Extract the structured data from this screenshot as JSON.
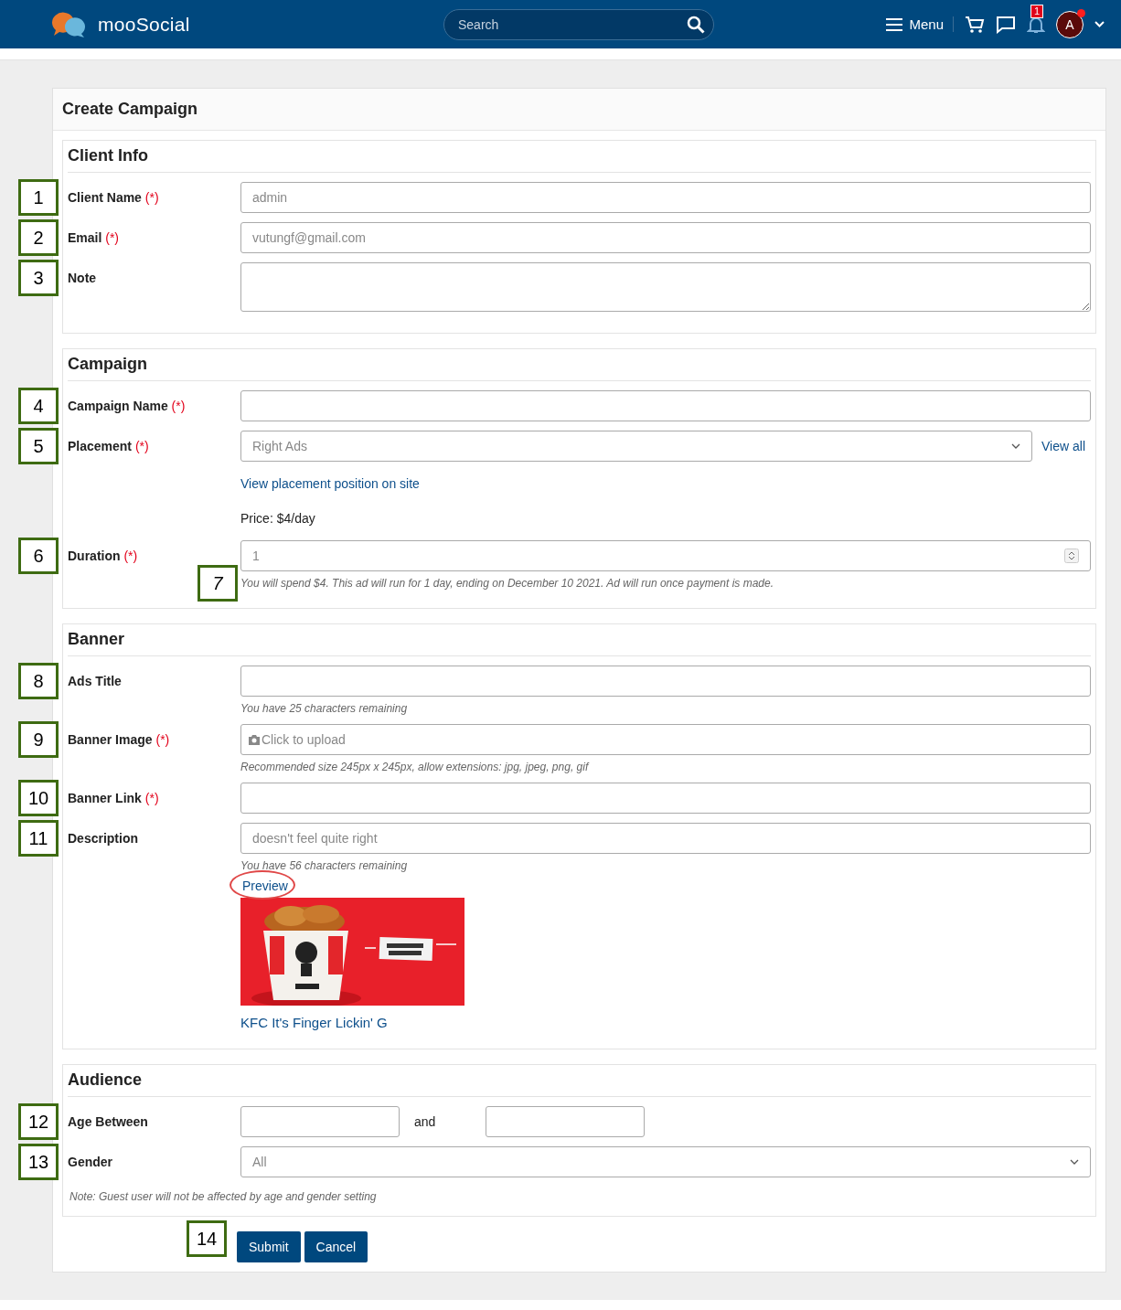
{
  "header": {
    "logo_text": "mooSocial",
    "search": {
      "placeholder": "Search"
    },
    "menu_label": "Menu",
    "notification_count": "1",
    "avatar_letter": "A"
  },
  "page": {
    "title": "Create Campaign"
  },
  "sections": [
    {
      "title": "Client Info",
      "rows": [
        {
          "kind": "input",
          "marker": "1",
          "label": "Client Name",
          "required_mark": "(*)",
          "value": "admin"
        },
        {
          "kind": "input",
          "marker": "2",
          "label": "Email",
          "required_mark": "(*)",
          "value": "vutungf@gmail.com"
        },
        {
          "kind": "textarea",
          "marker": "3",
          "label": "Note"
        }
      ]
    },
    {
      "title": "Campaign",
      "rows": [
        {
          "kind": "input",
          "marker": "4",
          "label": "Campaign Name",
          "required_mark": "(*)"
        },
        {
          "kind": "select",
          "marker": "5",
          "label": "Placement",
          "required_mark": "(*)",
          "value": "Right Ads",
          "link": "View all"
        },
        {
          "kind": "link",
          "text": "View placement position on site"
        },
        {
          "kind": "text",
          "text": "Price: $4/day"
        },
        {
          "kind": "number",
          "marker": "6",
          "label": "Duration",
          "required_mark": "(*)",
          "value": "1",
          "help": "You will spend $4. This ad will run for 1 day, ending on December 10 2021. Ad will run once payment is made.",
          "help_marker": "7"
        }
      ]
    },
    {
      "title": "Banner",
      "rows": [
        {
          "kind": "input",
          "marker": "8",
          "label": "Ads Title",
          "help": "You have 25 characters remaining"
        },
        {
          "kind": "upload",
          "marker": "9",
          "label": "Banner Image",
          "required_mark": "(*)",
          "placeholder": "Click to upload",
          "help": "Recommended size 245px x 245px, allow extensions: jpg, jpeg, png, gif"
        },
        {
          "kind": "input",
          "marker": "10",
          "label": "Banner Link",
          "required_mark": "(*)"
        },
        {
          "kind": "input",
          "marker": "11",
          "label": "Description",
          "value": "doesn't feel quite right",
          "help": "You have 56 characters remaining"
        },
        {
          "kind": "preview",
          "link": "Preview",
          "circled": true,
          "caption": "KFC It's Finger Lickin' G"
        }
      ]
    },
    {
      "title": "Audience",
      "rows": [
        {
          "kind": "range",
          "marker": "12",
          "label": "Age Between",
          "between": "and"
        },
        {
          "kind": "select",
          "marker": "13",
          "label": "Gender",
          "value": "All"
        },
        {
          "kind": "note",
          "text": "Note: Guest user will not be affected by age and gender setting"
        }
      ]
    }
  ],
  "actions": {
    "marker": "14",
    "buttons": [
      "Submit",
      "Cancel"
    ]
  }
}
